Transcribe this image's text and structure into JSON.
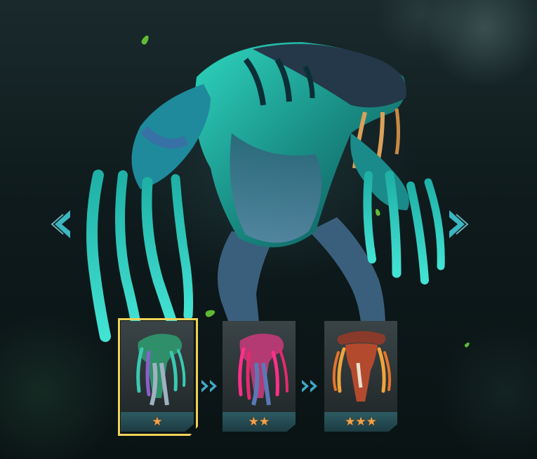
{
  "navigation": {
    "prev_icon": "chevron-left-icon",
    "next_icon": "chevron-right-icon"
  },
  "evolution_cards": [
    {
      "id": "stage-1",
      "stars": "★",
      "star_count": 1,
      "selected": true,
      "accent": "#2f8f6a"
    },
    {
      "id": "stage-2",
      "stars": "★★",
      "star_count": 2,
      "selected": false,
      "accent": "#d8326e"
    },
    {
      "id": "stage-3",
      "stars": "★★★",
      "star_count": 3,
      "selected": false,
      "accent": "#c8552a"
    }
  ],
  "colors": {
    "selected_frame": "#f0d25a",
    "star": "#f2a24a",
    "arrow": "#3fc9d6",
    "creature_skin": "#1fb6a6"
  }
}
